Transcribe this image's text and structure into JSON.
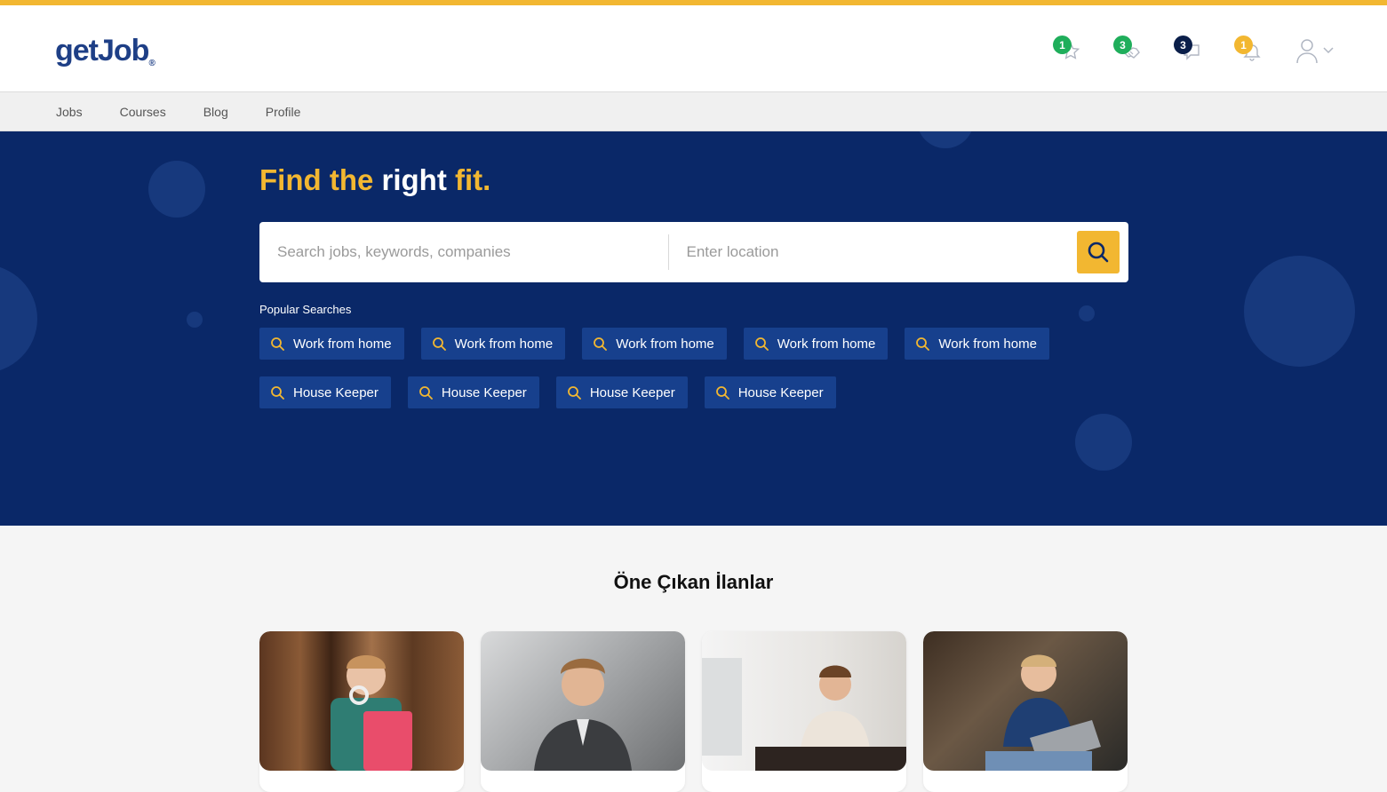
{
  "brand": {
    "logo_text": "getJob",
    "accent": "#f2b731",
    "navy": "#0a2868"
  },
  "header": {
    "icons": [
      {
        "name": "favorites-star-icon",
        "count": "1",
        "badge_color": "#1fae5b"
      },
      {
        "name": "handshake-icon",
        "count": "3",
        "badge_color": "#1fae5b"
      },
      {
        "name": "chat-bubble-icon",
        "count": "3",
        "badge_color": "#0b1f4a"
      },
      {
        "name": "bell-icon",
        "count": "1",
        "badge_color": "#f2b731"
      }
    ],
    "user_icon": "user-icon"
  },
  "nav": {
    "items": [
      "Jobs",
      "Courses",
      "Blog",
      "Profile"
    ]
  },
  "hero": {
    "headline": {
      "w1": "Find",
      "w2": "the",
      "w3": "right",
      "w4": "fit."
    },
    "search_placeholder": "Search jobs, keywords, companies",
    "location_placeholder": "Enter location",
    "popular_label": "Popular Searches",
    "popular_row1": [
      "Work from home",
      "Work from home",
      "Work from home",
      "Work from home",
      "Work from home"
    ],
    "popular_row2": [
      "House Keeper",
      "House Keeper",
      "House Keeper",
      "House Keeper"
    ]
  },
  "featured": {
    "title": "Öne Çıkan İlanlar"
  }
}
